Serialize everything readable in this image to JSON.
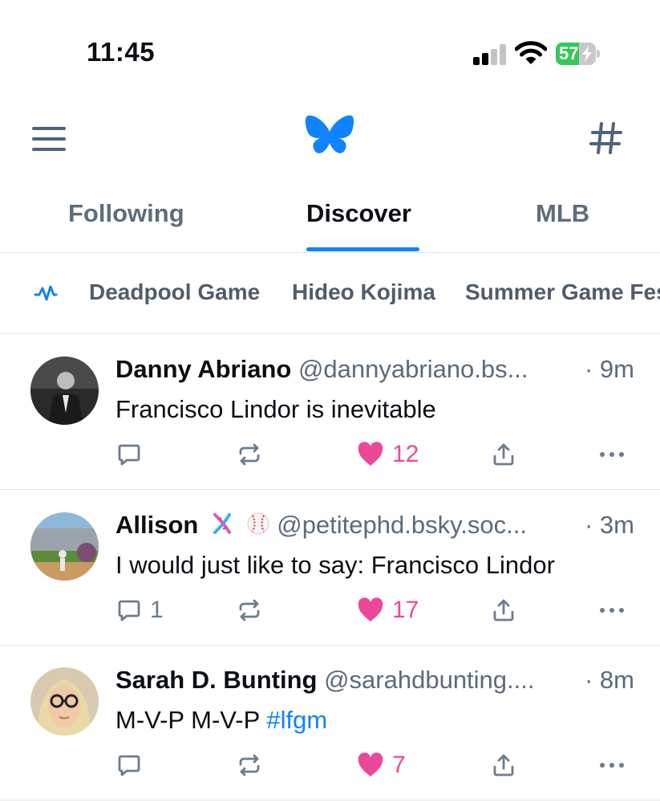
{
  "status_bar": {
    "time": "11:45",
    "battery_percent": "57",
    "battery_level": 0.57
  },
  "header": {
    "menu_icon": "hamburger-menu-icon",
    "logo_icon": "butterfly-logo-icon",
    "feeds_icon": "hash-icon"
  },
  "tabs": [
    {
      "label": "Following",
      "active": false
    },
    {
      "label": "Discover",
      "active": true
    },
    {
      "label": "MLB",
      "active": false
    }
  ],
  "trending": {
    "icon": "trending-wave-icon",
    "items": [
      "Deadpool Game",
      "Hideo Kojima",
      "Summer Game Fest"
    ]
  },
  "posts": [
    {
      "name": "Danny Abriano",
      "handle": "@dannyabriano.bs...",
      "time": "· 9m",
      "text": "Francisco Lindor is inevitable",
      "text_suffix": "",
      "hashtag": "",
      "replies": "",
      "likes": "12",
      "liked": true
    },
    {
      "name": "Allison",
      "handle": "@petitephd.bsky.soc...",
      "time": "· 3m",
      "text": "I would just like to say: Francisco Lindor",
      "text_suffix": "",
      "hashtag": "",
      "replies": "1",
      "likes": "17",
      "liked": true,
      "emojis": [
        "dna-emoji",
        "baseball-emoji"
      ]
    },
    {
      "name": "Sarah D. Bunting",
      "handle": "@sarahdbunting....",
      "time": "· 8m",
      "text": "M-V-P M-V-P ",
      "hashtag": "#lfgm",
      "replies": "",
      "likes": "7",
      "liked": true
    }
  ],
  "colors": {
    "accent": "#1083fe",
    "like": "#ec4899",
    "muted_icon": "#6b7c8d",
    "battery_green": "#34c759"
  }
}
